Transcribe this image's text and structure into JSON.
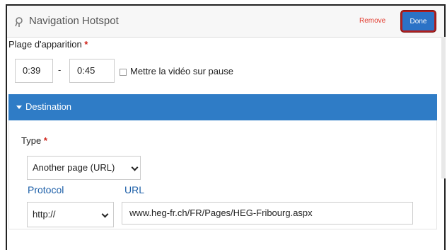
{
  "header": {
    "icon": "hotspot-pin-icon",
    "title": "Navigation Hotspot",
    "remove_label": "Remove",
    "done_label": "Done"
  },
  "timing": {
    "label": "Plage d'apparition",
    "required_mark": "*",
    "start": "0:39",
    "separator": "-",
    "end": "0:45",
    "pause_label": "Mettre la vidéo sur pause",
    "pause_checked": false
  },
  "destination": {
    "section_label": "Destination",
    "type_label": "Type",
    "required_mark": "*",
    "type_value": "Another page (URL)",
    "protocol_label": "Protocol",
    "protocol_value": "http://",
    "url_label": "URL",
    "url_value": "www.heg-fr.ch/FR/Pages/HEG-Fribourg.aspx"
  },
  "colors": {
    "accent": "#2f7cc6",
    "done_button": "#2b72c6",
    "done_outline": "#b01e1e",
    "remove": "#e23b2e",
    "required": "#d0241b",
    "label_blue": "#1d5fa8"
  }
}
